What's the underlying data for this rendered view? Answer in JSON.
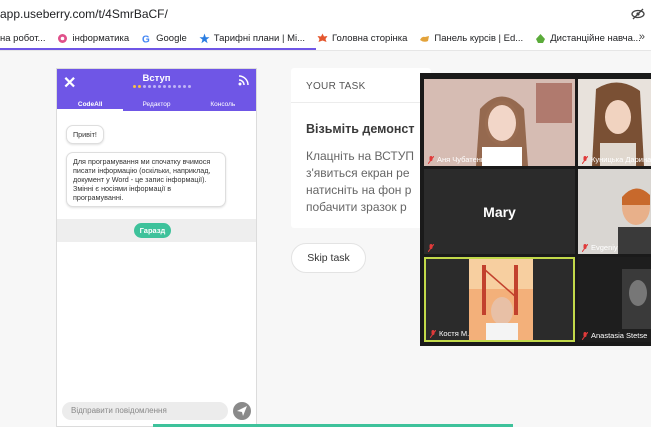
{
  "browser": {
    "url": "app.useberry.com/t/4SmrBaCF/",
    "bookmarks": [
      {
        "label": "на робот...",
        "icon": "bookmark-icon"
      },
      {
        "label": "інформатика",
        "icon": "flower-icon"
      },
      {
        "label": "Google",
        "icon": "google-icon"
      },
      {
        "label": "Тарифні плани | Мі...",
        "icon": "star-icon"
      },
      {
        "label": "Головна сторінка",
        "icon": "maple-icon"
      },
      {
        "label": "Панель курсів | Ed...",
        "icon": "hand-icon"
      },
      {
        "label": "Дистанційне навча...",
        "icon": "tray-icon"
      }
    ],
    "more": "»"
  },
  "app": {
    "title": "Вступ",
    "tabs": [
      "CodeAll",
      "Редактор",
      "Консоль"
    ],
    "messages": [
      "Привіт!",
      "Для програмування ми спочатку вчимося писати інформацію (оскільки, наприклад, документ у Word - це запис інформації). Змінні є носіями інформації в програмуванні."
    ],
    "ok_button": "Гаразд",
    "input_placeholder": "Відправити повідомлення"
  },
  "task": {
    "label": "YOUR TASK",
    "title": "Візьміть демонст",
    "desc_lines": [
      "Клацніть на ВСТУП",
      "з'явиться екран ре",
      "натисніть на фон р",
      "побачити зразок р"
    ],
    "skip_label": "Skip task"
  },
  "zoom": {
    "participants": [
      "Аня Чубатенко",
      "Куницька Дарина",
      "Mary",
      "Evgeniy",
      "Костя М.",
      "Anastasia Stetse"
    ]
  },
  "colors": {
    "brand": "#6f56e6",
    "accent_green": "#3ec29b",
    "active_speaker": "#c2d94a"
  }
}
